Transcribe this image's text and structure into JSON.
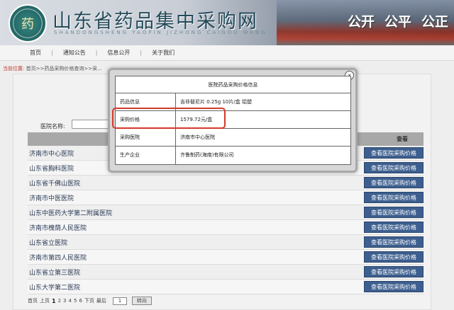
{
  "header": {
    "emblem_glyph": "药",
    "title": "山东省药品集中采购网",
    "subtitle": "SHANDONGSHENG YAOPIN JIZHONG CAIGOU WANG",
    "slogan": [
      "公开",
      "公平",
      "公正"
    ]
  },
  "nav": {
    "items": [
      "首页",
      "通知公告",
      "信息公开",
      "关于我们"
    ]
  },
  "breadcrumb": {
    "label": "当前位置:",
    "path": "首页>>药品采购价格查询>>采..."
  },
  "search": {
    "label": "医院名称:",
    "value": ""
  },
  "table": {
    "view_header": "查看",
    "rows": [
      {
        "hospital": "济南市中心医院",
        "button": "查看医院采购价格"
      },
      {
        "hospital": "山东省胸科医院",
        "button": "查看医院采购价格"
      },
      {
        "hospital": "山东省千佛山医院",
        "button": "查看医院采购价格"
      },
      {
        "hospital": "济南市中医医院",
        "button": "查看医院采购价格"
      },
      {
        "hospital": "山东中医药大学第二附属医院",
        "button": "查看医院采购价格"
      },
      {
        "hospital": "济南市槐荫人民医院",
        "button": "查看医院采购价格"
      },
      {
        "hospital": "山东省立医院",
        "button": "查看医院采购价格"
      },
      {
        "hospital": "济南市第四人民医院",
        "button": "查看医院采购价格"
      },
      {
        "hospital": "山东省立第三医院",
        "button": "查看医院采购价格"
      },
      {
        "hospital": "山东大学第二医院",
        "button": "查看医院采购价格"
      }
    ]
  },
  "pager": {
    "first": "首页",
    "prev": "上页",
    "current": "1",
    "pages": [
      "2",
      "3",
      "4",
      "5",
      "6"
    ],
    "next": "下页",
    "last": "最后",
    "input_value": "1",
    "go": "转向"
  },
  "dialog": {
    "close": "x",
    "title": "医院药品采购价格信息",
    "rows": [
      {
        "label": "药品信息",
        "value": "吉非替尼片 0.25g 10片/盒 铝塑"
      },
      {
        "label": "采购价格",
        "value": "1579.72元/盒"
      },
      {
        "label": "采购医院",
        "value": "济南市中心医院"
      },
      {
        "label": "生产企业",
        "value": "齐鲁制药(海南)有限公司"
      }
    ]
  },
  "colors": {
    "button_bg": "#3d5f8f",
    "highlight": "#d33a2c",
    "breadcrumb_label": "#c0392b"
  }
}
